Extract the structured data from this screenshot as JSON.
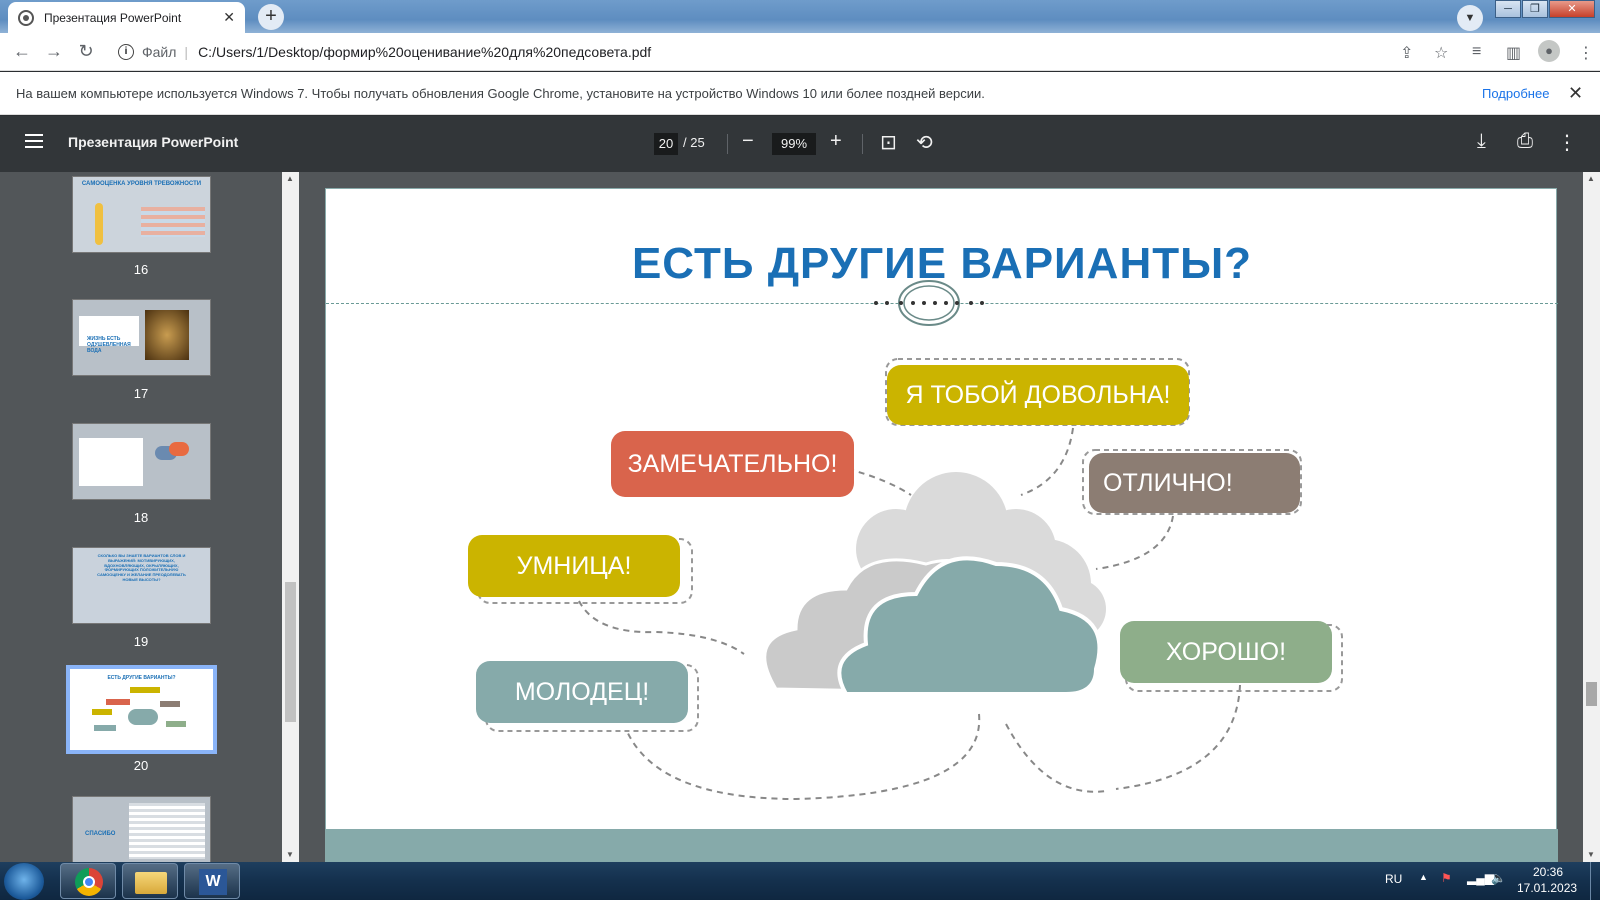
{
  "browser": {
    "tab_title": "Презентация PowerPoint",
    "tab_close": "✕",
    "new_tab": "+",
    "address_prefix": "Файл",
    "address": "C:/Users/1/Desktop/формир%20оценивание%20для%20педсовета.pdf"
  },
  "infobar": {
    "message": "На вашем компьютере используется Windows 7. Чтобы получать обновления Google Chrome, установите на устройство Windows 10 или более поздней версии.",
    "more_link": "Подробнее"
  },
  "pdf_toolbar": {
    "title": "Презентация PowerPoint",
    "current_page": "20",
    "total_pages": "/ 25",
    "zoom": "99%"
  },
  "sidebar": {
    "thumbnails": [
      {
        "page": "16",
        "heading": "САМООЦЕНКА УРОВНЯ ТРЕВОЖНОСТИ"
      },
      {
        "page": "17",
        "heading": "ЖИЗНЬ ЕСТЬ ОДУШЕВЛЕННАЯ ВОДА"
      },
      {
        "page": "18",
        "heading": ""
      },
      {
        "page": "19",
        "heading": "СКОЛЬКО ВЫ ЗНАЕТЕ ВАРИАНТОВ СЛОВ И ВЫРАЖЕНИЙ: МОТИВИРУЮЩИХ, ВДОХНОВЛЯЮЩИХ, ОКРЫЛЯЮЩИХ, ФОРМИРУЮЩИХ ПОЛОЖИТЕЛЬНУЮ САМООЦЕНКУ И ЖЕЛАНИЕ ПРЕОДОЛЕВАТЬ НОВЫЕ ВЫСОТЫ?"
      },
      {
        "page": "20",
        "heading": "ЕСТЬ ДРУГИЕ ВАРИАНТЫ?"
      },
      {
        "page": "",
        "heading": "СПАСИБО"
      }
    ]
  },
  "slide": {
    "title": "ЕСТЬ ДРУГИЕ ВАРИАНТЫ?",
    "bubbles": {
      "dovolna": "Я ТОБОЙ ДОВОЛЬНА!",
      "zamechatelno": "ЗАМЕЧАТЕЛЬНО!",
      "otlichno": "ОТЛИЧНО!",
      "umnitsa": "УМНИЦА!",
      "khorosho": "ХОРОШО!",
      "molodets": "МОЛОДЕЦ!"
    },
    "colors": {
      "title": "#1a6fb5",
      "yellow": "#cbb400",
      "red": "#d9644c",
      "brown": "#8c7d73",
      "teal": "#86aaaa",
      "green": "#8eae8a"
    }
  },
  "taskbar": {
    "lang": "RU",
    "time": "20:36",
    "date": "17.01.2023"
  }
}
